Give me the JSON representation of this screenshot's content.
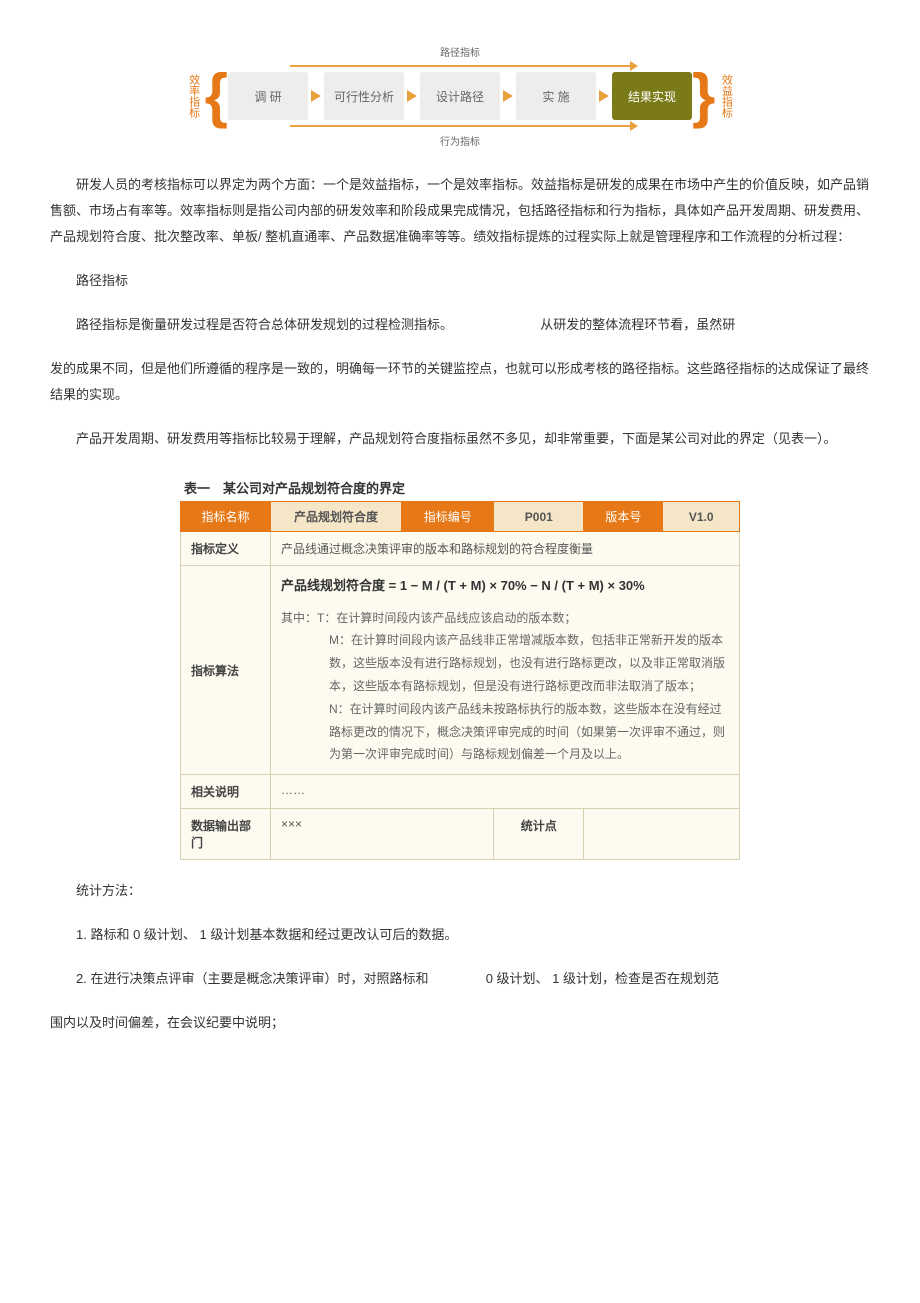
{
  "diagram": {
    "top_small_label": "路径指标",
    "left_side_label": "效率指标",
    "right_side_label": "效益指标",
    "step1": "调 研",
    "step2": "可行性分析",
    "step3": "设计路径",
    "step4": "实 施",
    "result": "结果实现",
    "bottom_small_label": "行为指标"
  },
  "body": {
    "p1": "研发人员的考核指标可以界定为两个方面：一个是效益指标，一个是效率指标。效益指标是研发的成果在市场中产生的价值反映，如产品销售额、市场占有率等。效率指标则是指公司内部的研发效率和阶段成果完成情况，包括路径指标和行为指标，具体如产品开发周期、研发费用、产品规划符合度、批次整改率、单板/ 整机直通率、产品数据准确率等等。绩效指标提炼的过程实际上就是管理程序和工作流程的分析过程：",
    "p2": "路径指标",
    "p3a": "路径指标是衡量研发过程是否符合总体研发规划的过程检测指标。",
    "p3b": "从研发的整体流程环节看，虽然研",
    "p3c": "发的成果不同，但是他们所遵循的程序是一致的，明确每一环节的关键监控点，也就可以形成考核的路径指标。这些路径指标的达成保证了最终结果的实现。",
    "p4": "产品开发周期、研发费用等指标比较易于理解，产品规划符合度指标虽然不多见，却非常重要，下面是某公司对此的界定（见表一）。"
  },
  "table": {
    "title": "表一　某公司对产品规划符合度的界定",
    "h_name": "指标名称",
    "v_name": "产品规划符合度",
    "h_code": "指标编号",
    "v_code": "P001",
    "h_ver": "版本号",
    "v_ver": "V1.0",
    "def_label": "指标定义",
    "def_val": "产品线通过概念决策评审的版本和路标规划的符合程度衡量",
    "algo_label": "指标算法",
    "formula": "产品线规划符合度 = 1 − M / (T + M) × 70% − N / (T + M) × 30%",
    "where": "其中：T：在计算时间段内该产品线应该启动的版本数；",
    "m": "M：在计算时间段内该产品线非正常增减版本数，包括非正常新开发的版本数，这些版本没有进行路标规划，也没有进行路标更改，以及非正常取消版本，这些版本有路标规划，但是没有进行路标更改而非法取消了版本；",
    "n": "N：在计算时间段内该产品线未按路标执行的版本数，这些版本在没有经过路标更改的情况下，概念决策评审完成的时间（如果第一次评审不通过，则为第一次评审完成时间）与路标规划偏差一个月及以上。",
    "note_label": "相关说明",
    "note_val": "……",
    "out_label": "数据输出部门",
    "out_val": "×××",
    "stat_label": "统计点"
  },
  "tail": {
    "stat_method_h": "统计方法：",
    "item1": "1. 路标和 0 级计划、 1 级计划基本数据和经过更改认可后的数据。",
    "item2a": "2. 在进行决策点评审（主要是概念决策评审）时，对照路标和",
    "item2b": "0 级计划、 1 级计划，检查是否在规划范",
    "item2c": "围内以及时间偏差，在会议纪要中说明；"
  }
}
